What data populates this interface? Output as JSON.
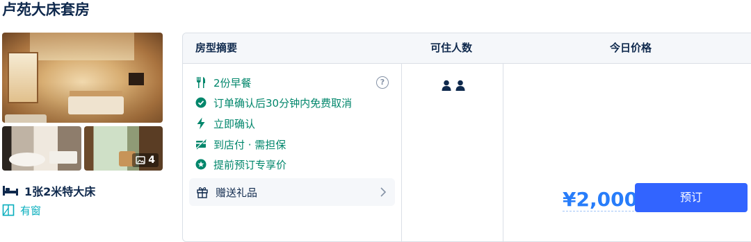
{
  "room": {
    "title": "卢苑大床套房",
    "bed": "1张2米特大床",
    "window": "有窗",
    "photo_count": "4"
  },
  "table": {
    "headers": {
      "summary": "房型摘要",
      "occupancy": "可住人数",
      "price": "今日价格"
    },
    "benefits": [
      {
        "icon": "utensils-icon",
        "text": "2份早餐"
      },
      {
        "icon": "check-circle-icon",
        "text": "订单确认后30分钟内免费取消"
      },
      {
        "icon": "lightning-icon",
        "text": "立即确认"
      },
      {
        "icon": "pay-at-hotel-icon",
        "text": "到店付 · 需担保"
      },
      {
        "icon": "star-badge-icon",
        "text": "提前预订专享价"
      }
    ],
    "gift": "赠送礼品",
    "help_symbol": "?",
    "guests": 2,
    "price": "¥2,000",
    "book_label": "预订"
  },
  "colors": {
    "green": "#00866b",
    "teal": "#06aebd",
    "blue": "#287dfa",
    "button": "#3264ff",
    "text": "#0f294d"
  }
}
